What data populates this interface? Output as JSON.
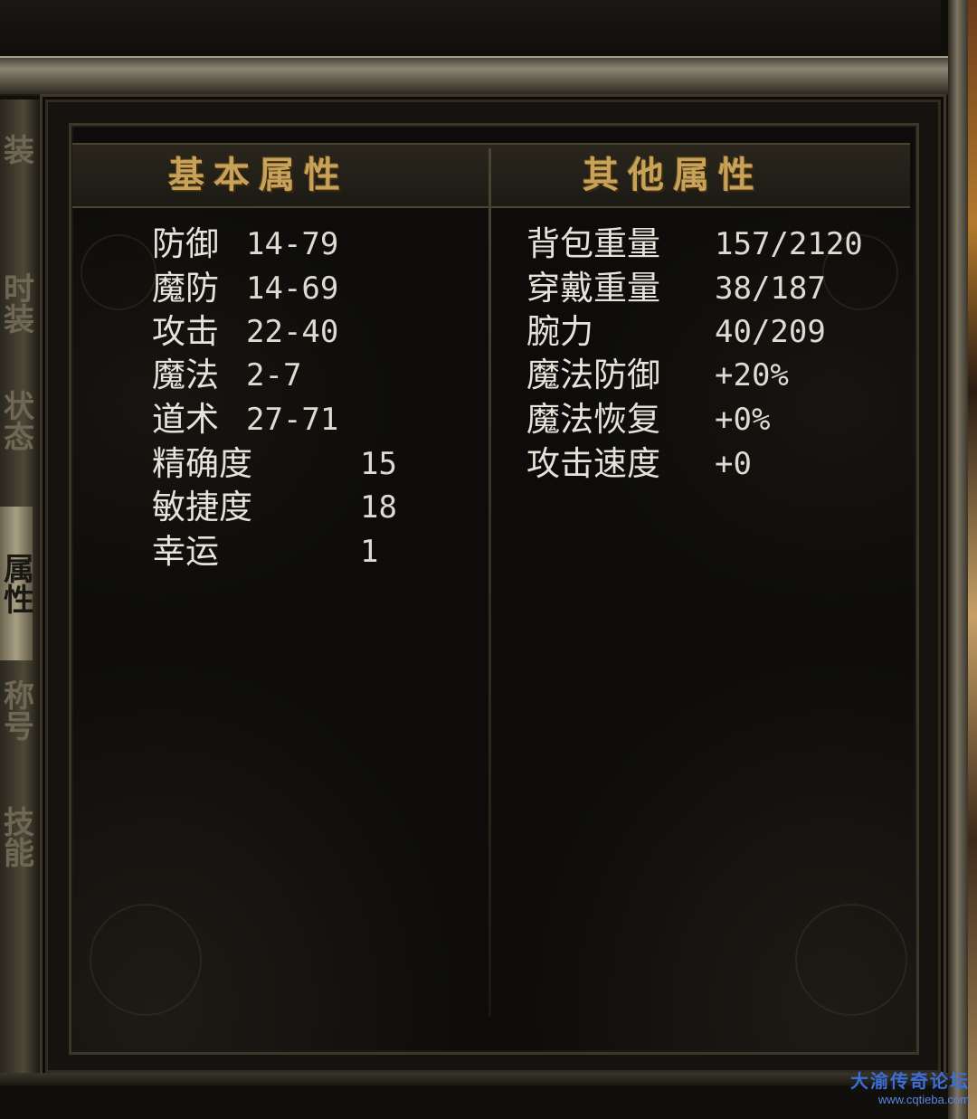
{
  "left_tabs": [
    "装",
    "时装",
    "状态",
    "属性",
    "称号",
    "技能"
  ],
  "headers": {
    "basic": "基本属性",
    "other": "其他属性"
  },
  "basic_stats": [
    {
      "label": "防御",
      "value": "14-79"
    },
    {
      "label": "魔防",
      "value": "14-69"
    },
    {
      "label": "攻击",
      "value": "22-40"
    },
    {
      "label": "魔法",
      "value": "2-7"
    },
    {
      "label": "道术",
      "value": "27-71"
    },
    {
      "label": "精确度",
      "value": "15"
    },
    {
      "label": "敏捷度",
      "value": "18"
    },
    {
      "label": "幸运",
      "value": "1"
    }
  ],
  "other_stats": [
    {
      "label": "背包重量",
      "value": "157/2120"
    },
    {
      "label": "穿戴重量",
      "value": "38/187"
    },
    {
      "label": "腕力",
      "value": "40/209"
    },
    {
      "label": "魔法防御",
      "value": "+20%"
    },
    {
      "label": "魔法恢复",
      "value": "+0%"
    },
    {
      "label": "攻击速度",
      "value": "+0"
    }
  ],
  "watermark": {
    "title": "大渝传奇论坛",
    "url": "www.cqtieba.com"
  },
  "colors": {
    "header_gold": "#c9a25a",
    "stat_text": "#e6e3da",
    "watermark_blue": "#3d6fd8"
  }
}
